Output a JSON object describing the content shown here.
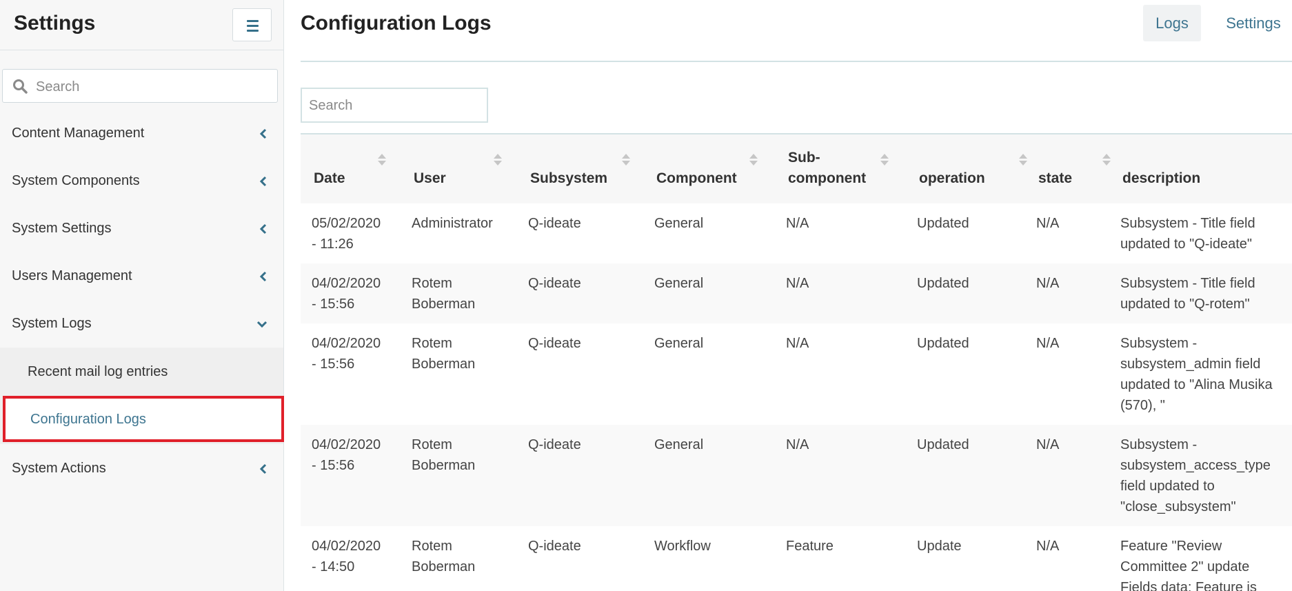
{
  "sidebar": {
    "title": "Settings",
    "search_placeholder": "Search",
    "items": [
      {
        "label": "Content Management"
      },
      {
        "label": "System Components"
      },
      {
        "label": "System Settings"
      },
      {
        "label": "Users Management"
      },
      {
        "label": "System Logs",
        "expanded": true
      },
      {
        "label": "System Actions"
      }
    ],
    "sub_items": [
      {
        "label": "Recent mail log entries"
      },
      {
        "label": "Configuration Logs",
        "active": true
      }
    ]
  },
  "header": {
    "title": "Configuration Logs",
    "tabs": [
      {
        "label": "Logs",
        "active": true
      },
      {
        "label": "Settings"
      }
    ]
  },
  "main": {
    "search_placeholder": "Search"
  },
  "table": {
    "columns": [
      {
        "line1": "",
        "line2": "Date"
      },
      {
        "line1": "",
        "line2": "User"
      },
      {
        "line1": "",
        "line2": "Subsystem"
      },
      {
        "line1": "",
        "line2": "Component"
      },
      {
        "line1": "Sub-",
        "line2": "component"
      },
      {
        "line1": "",
        "line2": "operation"
      },
      {
        "line1": "",
        "line2": "state"
      },
      {
        "line1": "",
        "line2": "description"
      }
    ],
    "rows": [
      {
        "date": [
          "05/02/2020",
          "- 11:26"
        ],
        "user": [
          "Administrator"
        ],
        "subsystem": "Q-ideate",
        "component": "General",
        "subcomponent": "N/A",
        "operation": "Updated",
        "state": "N/A",
        "description": [
          "Subsystem - Title field",
          "updated to \"Q-ideate\""
        ]
      },
      {
        "date": [
          "04/02/2020",
          "- 15:56"
        ],
        "user": [
          "Rotem",
          "Boberman"
        ],
        "subsystem": "Q-ideate",
        "component": "General",
        "subcomponent": "N/A",
        "operation": "Updated",
        "state": "N/A",
        "description": [
          "Subsystem - Title field",
          "updated to \"Q-rotem\""
        ]
      },
      {
        "date": [
          "04/02/2020",
          "- 15:56"
        ],
        "user": [
          "Rotem",
          "Boberman"
        ],
        "subsystem": "Q-ideate",
        "component": "General",
        "subcomponent": "N/A",
        "operation": "Updated",
        "state": "N/A",
        "description": [
          "Subsystem -",
          "subsystem_admin field",
          "updated to \"Alina Musika",
          "(570), \""
        ]
      },
      {
        "date": [
          "04/02/2020",
          "- 15:56"
        ],
        "user": [
          "Rotem",
          "Boberman"
        ],
        "subsystem": "Q-ideate",
        "component": "General",
        "subcomponent": "N/A",
        "operation": "Updated",
        "state": "N/A",
        "description": [
          "Subsystem -",
          "subsystem_access_type",
          "field updated to",
          "\"close_subsystem\""
        ]
      },
      {
        "date": [
          "04/02/2020",
          "- 14:50"
        ],
        "user": [
          "Rotem",
          "Boberman"
        ],
        "subsystem": "Q-ideate",
        "component": "Workflow",
        "subcomponent": "Feature",
        "operation": "Update",
        "state": "N/A",
        "description": [
          "Feature \"Review",
          "Committee 2\" update",
          "Fields data: Feature is"
        ]
      }
    ]
  }
}
